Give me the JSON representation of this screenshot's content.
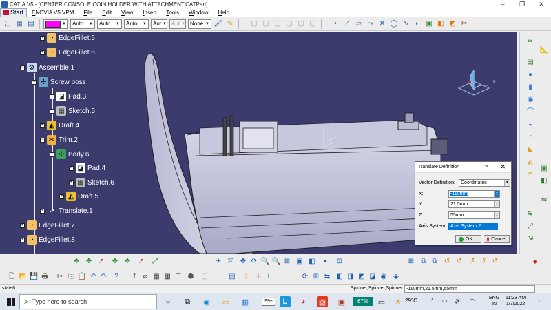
{
  "window": {
    "title": "CATIA V5 - [CENTER CONSOLE COIN HOLDER WITH ATTACHMENT.CATPart]",
    "minimize": "–",
    "restore": "❐",
    "close": "✕"
  },
  "menu": {
    "start": "Start",
    "items": [
      "ENOVIA V5 VPM",
      "File",
      "Edit",
      "View",
      "Insert",
      "Tools",
      "Window",
      "Help"
    ]
  },
  "toolbar": {
    "fill_color": "#ff00ff",
    "selects": [
      "Auto",
      "Auto",
      "Auto",
      "Aut",
      "Aut",
      "None"
    ]
  },
  "tree": {
    "nodes": [
      {
        "label": "EdgeFillet.5",
        "icon": "edge-fillet-icon"
      },
      {
        "label": "EdgeFillet.6",
        "icon": "edge-fillet-icon"
      },
      {
        "label": "Assemble.1",
        "icon": "assemble-icon"
      },
      {
        "label": "Screw boss",
        "icon": "body-icon"
      },
      {
        "label": "Pad.3",
        "icon": "pad-icon"
      },
      {
        "label": "Sketch.5",
        "icon": "sketch-icon"
      },
      {
        "label": "Draft.4",
        "icon": "draft-icon"
      },
      {
        "label": "Trim.2",
        "icon": "trim-icon"
      },
      {
        "label": "Body.6",
        "icon": "body-icon"
      },
      {
        "label": "Pad.4",
        "icon": "pad-icon"
      },
      {
        "label": "Sketch.6",
        "icon": "sketch-icon"
      },
      {
        "label": "Draft.5",
        "icon": "draft-icon"
      },
      {
        "label": "Translate.1",
        "icon": "translate-icon"
      },
      {
        "label": "EdgeFillet.7",
        "icon": "edge-fillet-icon"
      },
      {
        "label": "EdgeFillet.8",
        "icon": "edge-fillet-icon"
      }
    ]
  },
  "compass": {
    "x_label": "x"
  },
  "dialog": {
    "title": "Translate Definition",
    "help": "?",
    "close": "✕",
    "vector_definition_label": "Vector Definition:",
    "vector_definition_value": "Coordinates",
    "x_label": "X:",
    "x_value": "-110mm",
    "y_label": "Y:",
    "y_value": "21.5mm",
    "z_label": "Z:",
    "z_value": "55mm",
    "axis_label": "Axis System:",
    "axis_value": "Axis System.2",
    "ok_label": "OK",
    "cancel_label": "Cancel"
  },
  "status": {
    "state": "state6",
    "spinner_label": "Spinner,Spinner,Spinner",
    "command_value": "-110mm,21.5mm,55mm"
  },
  "taskbar": {
    "search_placeholder": "Type here to search",
    "badge": "99+",
    "battery": "67%",
    "temperature": "29°C",
    "language_1": "ENG",
    "language_2": "IN",
    "time": "11:23 AM",
    "date": "1/7/2022"
  }
}
